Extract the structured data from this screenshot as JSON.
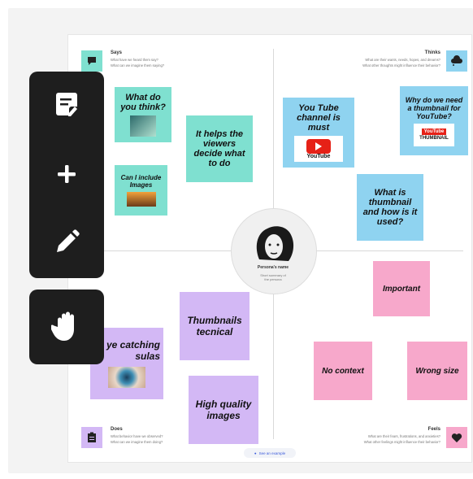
{
  "board": {
    "quadrants": {
      "says": {
        "title": "Says",
        "line1": "What have we heard them say?",
        "line2": "What can we imagine them saying?"
      },
      "thinks": {
        "title": "Thinks",
        "line1": "What are their wants, needs, hopes, and dreams?",
        "line2": "What other thoughts might influence their behavior?"
      },
      "does": {
        "title": "Does",
        "line1": "What behavior have we observed?",
        "line2": "What can we imagine them doing?"
      },
      "feels": {
        "title": "Feels",
        "line1": "What are their fears, frustrations, and anxieties?",
        "line2": "What other feelings might influence their behavior?"
      }
    },
    "persona": {
      "name": "Persona's name",
      "sub1": "Short summary of",
      "sub2": "the persona"
    },
    "pill_label": "See an example"
  },
  "notes": {
    "what_do_you_think": "What do you think?",
    "can_i_include_images": "Can I include Images",
    "helps_viewers": "It helps the viewers decide what to do",
    "youtube_channel": "You Tube channel is must",
    "why_thumbnail": "Why do we need a thumbnail for YouTube?",
    "what_is_thumbnail": "What is thumbnail and how is it used?",
    "important": "Important",
    "no_context": "No context",
    "wrong_size": "Wrong size",
    "thumbnails_tecnical": "Thumbnails tecnical",
    "eye_catching": "ye catching sulas",
    "high_quality": "High quality images"
  },
  "logos": {
    "youtube_word": "YouTube",
    "thumbnail_word": "THUMBNAIL"
  },
  "toolbar": {
    "icons": [
      "sticky-note-icon",
      "plus-icon",
      "pencil-icon",
      "hand-icon"
    ]
  },
  "colors": {
    "teal": "#7fe0d0",
    "blue": "#8fd3f0",
    "purple": "#d3b8f5",
    "pink": "#f7a8cb",
    "toolbar": "#1e1e1e"
  }
}
